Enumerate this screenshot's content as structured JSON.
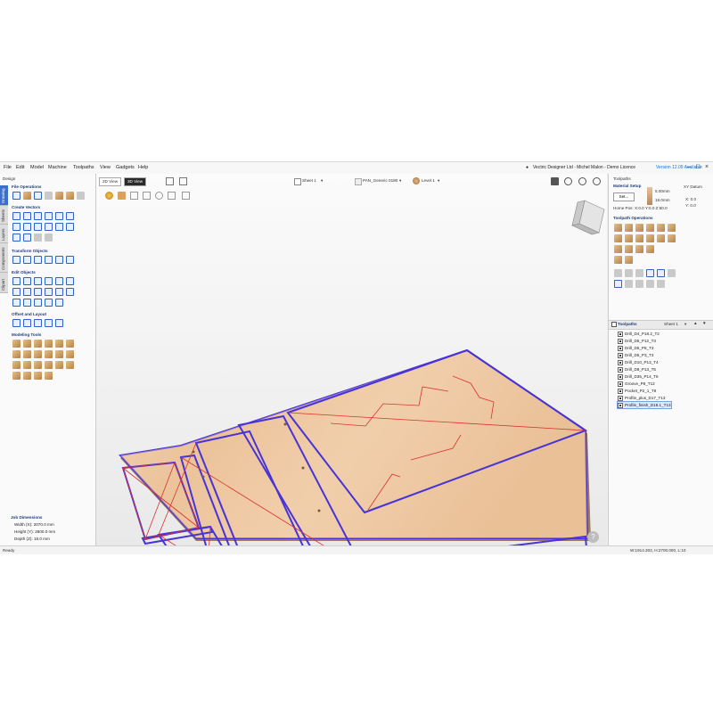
{
  "menu": {
    "items": [
      "File",
      "Edit",
      "Model",
      "Machine",
      "Toolpaths",
      "View",
      "Gadgets",
      "Help"
    ],
    "app_title": "Vectric Designer Ltd - Michel Malon - Demo Licence",
    "version_notice": "Version 12.09 Available",
    "win_controls": [
      "–",
      "□",
      "×"
    ]
  },
  "left_panel": {
    "header": "Design",
    "tabs": [
      "Drawing",
      "Sheets",
      "Layers",
      "Components",
      "Clipart"
    ],
    "sections": [
      "File Operations",
      "Create Vectors",
      "Transform Objects",
      "Edit Objects",
      "Offset and Layout",
      "Modeling Tools"
    ],
    "job": {
      "title": "Job Dimensions",
      "width": "Width (X): 2070.0 mm",
      "height": "Height (Y): 2800.0 mm",
      "depth": "Depth (Z): 18.0 mm"
    }
  },
  "viewport": {
    "tab_2d": "2D View",
    "tab_3d": "3D View",
    "sheet_select": "Sheet 1",
    "material_select": "PAN_Generic 0180",
    "level_select": "Level 1",
    "help": "?"
  },
  "right_panel": {
    "header": "Toolpaths",
    "material_setup": "Material Setup",
    "set_button": "Set...",
    "mat_z": "Z: 18.0mm",
    "offset_label": "XY Datum",
    "mat_val1": "5.00mm",
    "mat_val2": "18.0mm",
    "home_pos": "Home Pos: X:0.0 Y:0.0 Z:60.0",
    "datum_x": "X: 0.0",
    "datum_y": "Y: 0.0",
    "ops_title": "Toolpath Operations",
    "toolpaths_title": "Toolpaths",
    "sheet": "Sheet 1",
    "toolpaths": [
      {
        "label": "Drill_D4_P18.2_T2",
        "checked": true,
        "selected": false
      },
      {
        "label": "Drill_D5_P12_T3",
        "checked": true,
        "selected": false
      },
      {
        "label": "Drill_D5_P8_T3",
        "checked": true,
        "selected": false
      },
      {
        "label": "Drill_D5_P3_T3",
        "checked": true,
        "selected": false
      },
      {
        "label": "Drill_D10_P13_T4",
        "checked": true,
        "selected": false
      },
      {
        "label": "Drill_D8_P13_T5",
        "checked": true,
        "selected": false
      },
      {
        "label": "Drill_D35_P14_T6",
        "checked": true,
        "selected": false
      },
      {
        "label": "Groove_P8_T12",
        "checked": true,
        "selected": false
      },
      {
        "label": "Pocket_P2_1_T8",
        "checked": true,
        "selected": false
      },
      {
        "label": "Profile_plus_D17_T13",
        "checked": true,
        "selected": false
      },
      {
        "label": "Profile_finish_D18.1_T13",
        "checked": true,
        "selected": true
      }
    ]
  },
  "status": {
    "left": "Ready",
    "right": "W:1914.303, H:2700.000, L:10"
  },
  "colors": {
    "sheet_wood": "#f0c9a4",
    "vector_blue": "#4733d6",
    "vector_red": "#d8322e",
    "accent": "#1d3f7a"
  }
}
